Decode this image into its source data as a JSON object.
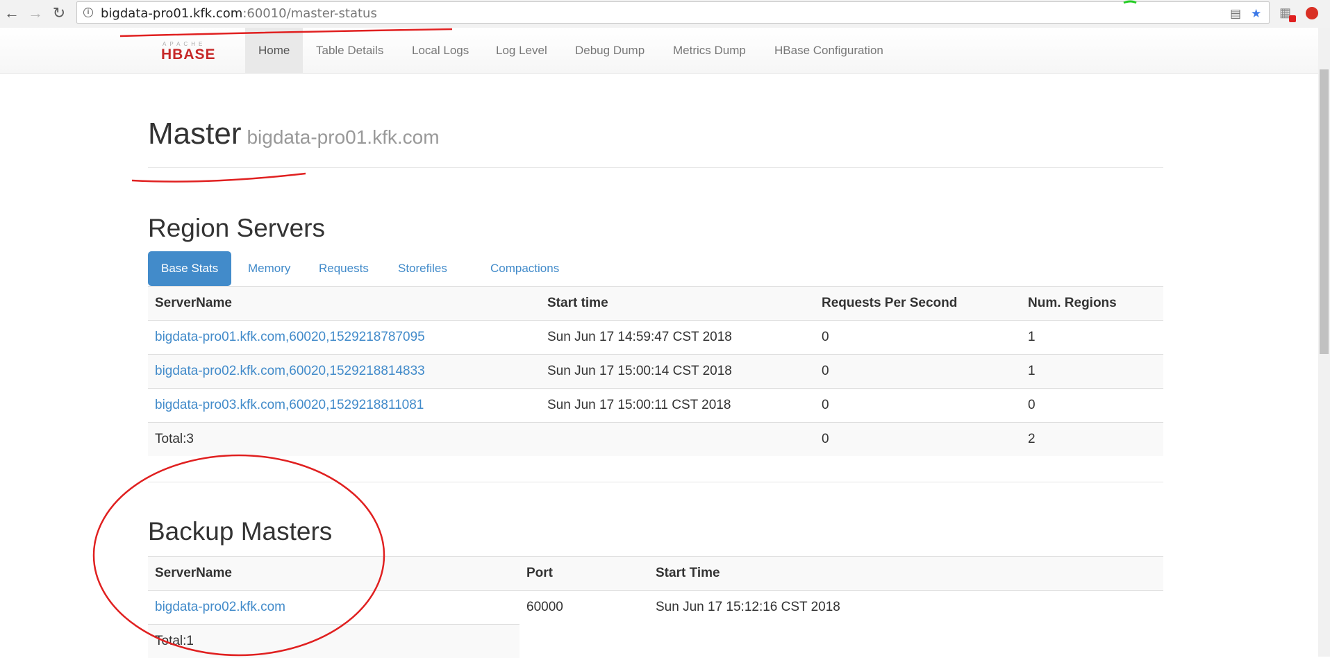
{
  "browser": {
    "url_host": "bigdata-pro01.kfk.com",
    "url_rest": ":60010/master-status"
  },
  "navbar": {
    "logo_top": "APACHE",
    "logo_main": "HBASE",
    "items": [
      {
        "label": "Home",
        "active": true
      },
      {
        "label": "Table Details"
      },
      {
        "label": "Local Logs"
      },
      {
        "label": "Log Level"
      },
      {
        "label": "Debug Dump"
      },
      {
        "label": "Metrics Dump"
      },
      {
        "label": "HBase Configuration"
      }
    ]
  },
  "header": {
    "title": "Master",
    "subtitle": "bigdata-pro01.kfk.com"
  },
  "region_servers": {
    "title": "Region Servers",
    "tabs": [
      "Base Stats",
      "Memory",
      "Requests",
      "Storefiles",
      "Compactions"
    ],
    "columns": [
      "ServerName",
      "Start time",
      "Requests Per Second",
      "Num. Regions"
    ],
    "rows": [
      [
        "bigdata-pro01.kfk.com,60020,1529218787095",
        "Sun Jun 17 14:59:47 CST 2018",
        "0",
        "1"
      ],
      [
        "bigdata-pro02.kfk.com,60020,1529218814833",
        "Sun Jun 17 15:00:14 CST 2018",
        "0",
        "1"
      ],
      [
        "bigdata-pro03.kfk.com,60020,1529218811081",
        "Sun Jun 17 15:00:11 CST 2018",
        "0",
        "0"
      ]
    ],
    "total": {
      "label": "Total:3",
      "requests": "0",
      "regions": "2"
    }
  },
  "backup_masters": {
    "title": "Backup Masters",
    "columns": [
      "ServerName",
      "Port",
      "Start Time"
    ],
    "rows": [
      [
        "bigdata-pro02.kfk.com",
        "60000",
        "Sun Jun 17 15:12:16 CST 2018"
      ]
    ],
    "total": "Total:1"
  },
  "colors": {
    "link": "#428bca",
    "annotation": "#e02020"
  }
}
